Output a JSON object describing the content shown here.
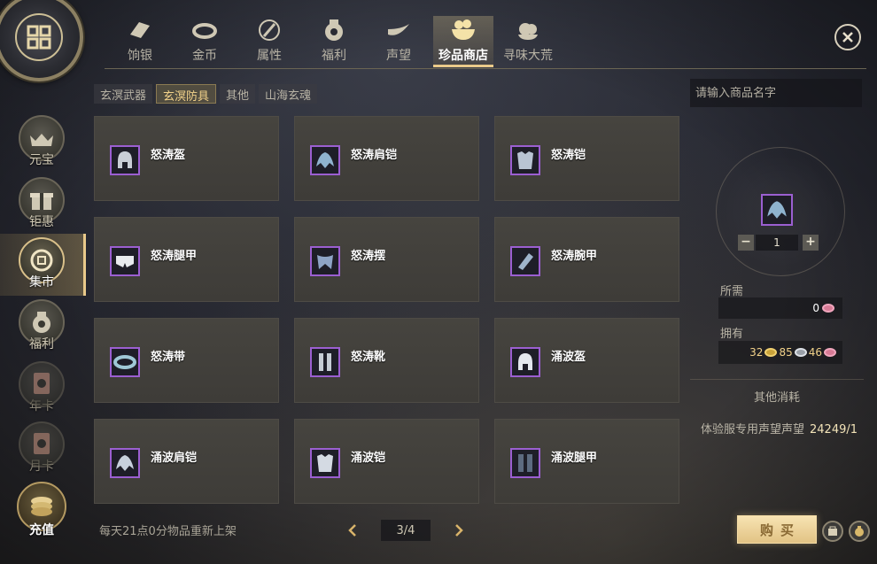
{
  "top_tabs": [
    {
      "label": "饷银",
      "icon": "ingot-icon"
    },
    {
      "label": "金币",
      "icon": "coin-icon"
    },
    {
      "label": "属性",
      "icon": "sword-icon"
    },
    {
      "label": "福利",
      "icon": "moneybag-icon"
    },
    {
      "label": "声望",
      "icon": "horn-icon"
    },
    {
      "label": "珍品商店",
      "icon": "treasure-bowl-icon",
      "active": true
    },
    {
      "label": "寻味大荒",
      "icon": "fruit-plate-icon"
    }
  ],
  "sidebar": [
    {
      "label": "元宝",
      "icon": "gold-ingot-icon"
    },
    {
      "label": "钜惠",
      "icon": "gift-box-icon"
    },
    {
      "label": "集市",
      "icon": "coin-pouch-icon",
      "active": true
    },
    {
      "label": "福利",
      "icon": "welfare-bag-icon"
    },
    {
      "label": "年卡",
      "icon": "year-card-icon",
      "dim": true
    },
    {
      "label": "月卡",
      "icon": "month-card-icon",
      "dim": true
    },
    {
      "label": "充值",
      "icon": "recharge-coin-icon"
    }
  ],
  "subtabs": [
    {
      "label": "玄溟武器"
    },
    {
      "label": "玄溟防具",
      "active": true
    },
    {
      "label": "其他"
    },
    {
      "label": "山海玄魂"
    }
  ],
  "items": [
    {
      "name": "怒涛盔",
      "icon": "helmet-icon"
    },
    {
      "name": "怒涛肩铠",
      "icon": "shoulder-armor-icon"
    },
    {
      "name": "怒涛铠",
      "icon": "chest-armor-icon"
    },
    {
      "name": "怒涛腿甲",
      "icon": "leg-armor-icon"
    },
    {
      "name": "怒涛摆",
      "icon": "waist-cloth-icon"
    },
    {
      "name": "怒涛腕甲",
      "icon": "bracer-icon"
    },
    {
      "name": "怒涛带",
      "icon": "belt-icon"
    },
    {
      "name": "怒涛靴",
      "icon": "boots-icon"
    },
    {
      "name": "涌波盔",
      "icon": "helmet-icon"
    },
    {
      "name": "涌波肩铠",
      "icon": "shoulder-armor-icon"
    },
    {
      "name": "涌波铠",
      "icon": "chest-armor-icon"
    },
    {
      "name": "涌波腿甲",
      "icon": "leg-armor-icon"
    }
  ],
  "footer": {
    "notice": "每天21点0分物品重新上架",
    "page": "3/4"
  },
  "right_panel": {
    "search_placeholder": "请输入商品名字",
    "quantity": "1",
    "minus": "−",
    "plus": "+",
    "required_label": "所需",
    "required_value": "0",
    "owned_label": "拥有",
    "owned": [
      {
        "value": "32",
        "coin": "gold"
      },
      {
        "value": "85",
        "coin": "silver"
      },
      {
        "value": "46",
        "coin": "pink"
      }
    ],
    "other_cost_title": "其他消耗",
    "other_cost_label": "体验服专用声望声望",
    "other_cost_value": "24249/1",
    "buy_label": "购买"
  },
  "colors": {
    "accent_gold": "#e9c98a",
    "item_border_purple": "#9b5fd1",
    "panel_bg": "#3e3c38"
  }
}
